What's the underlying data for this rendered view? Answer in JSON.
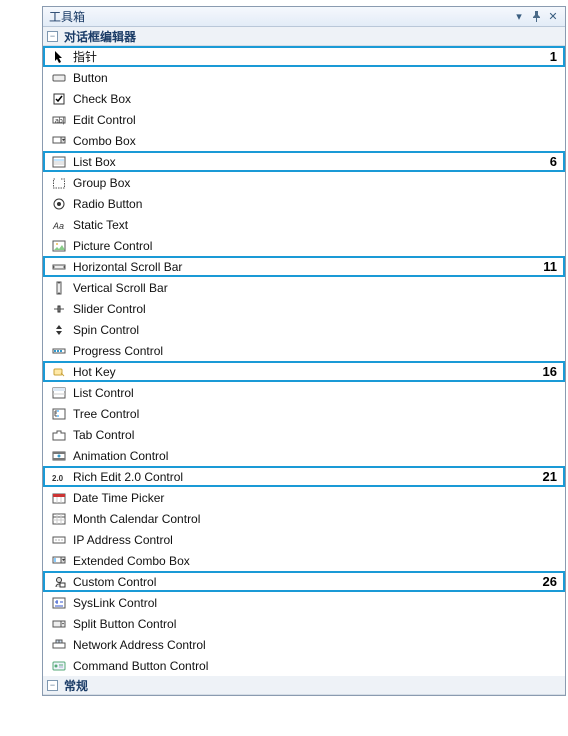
{
  "panel": {
    "title": "工具箱",
    "dropdown_label": "▾",
    "pin_label": "☍",
    "close_label": "✕"
  },
  "groups": {
    "dialog_editor": {
      "label": "对话框编辑器"
    },
    "general": {
      "label": "常规"
    }
  },
  "items": [
    {
      "icon": "pointer-icon",
      "label": "指针"
    },
    {
      "icon": "button-icon",
      "label": "Button"
    },
    {
      "icon": "checkbox-icon",
      "label": "Check Box"
    },
    {
      "icon": "edit-icon",
      "label": "Edit Control"
    },
    {
      "icon": "combo-icon",
      "label": "Combo Box"
    },
    {
      "icon": "listbox-icon",
      "label": "List Box"
    },
    {
      "icon": "groupbox-icon",
      "label": "Group Box"
    },
    {
      "icon": "radio-icon",
      "label": "Radio Button"
    },
    {
      "icon": "static-icon",
      "label": "Static Text"
    },
    {
      "icon": "picture-icon",
      "label": "Picture Control"
    },
    {
      "icon": "hscroll-icon",
      "label": "Horizontal Scroll Bar"
    },
    {
      "icon": "vscroll-icon",
      "label": "Vertical Scroll Bar"
    },
    {
      "icon": "slider-icon",
      "label": "Slider Control"
    },
    {
      "icon": "spin-icon",
      "label": "Spin Control"
    },
    {
      "icon": "progress-icon",
      "label": "Progress Control"
    },
    {
      "icon": "hotkey-icon",
      "label": "Hot Key"
    },
    {
      "icon": "listctrl-icon",
      "label": "List Control"
    },
    {
      "icon": "tree-icon",
      "label": "Tree Control"
    },
    {
      "icon": "tab-icon",
      "label": "Tab Control"
    },
    {
      "icon": "animation-icon",
      "label": "Animation Control"
    },
    {
      "icon": "richedit-icon",
      "label": "Rich Edit 2.0 Control"
    },
    {
      "icon": "datetime-icon",
      "label": "Date Time Picker"
    },
    {
      "icon": "month-icon",
      "label": "Month Calendar Control"
    },
    {
      "icon": "ip-icon",
      "label": "IP Address Control"
    },
    {
      "icon": "extcombo-icon",
      "label": "Extended Combo Box"
    },
    {
      "icon": "custom-icon",
      "label": "Custom Control"
    },
    {
      "icon": "syslink-icon",
      "label": "SysLink Control"
    },
    {
      "icon": "splitbtn-icon",
      "label": "Split Button Control"
    },
    {
      "icon": "network-icon",
      "label": "Network Address Control"
    },
    {
      "icon": "cmdbtn-icon",
      "label": "Command Button Control"
    }
  ],
  "highlights": {
    "0": "1",
    "5": "6",
    "10": "11",
    "15": "16",
    "20": "21",
    "25": "26"
  }
}
